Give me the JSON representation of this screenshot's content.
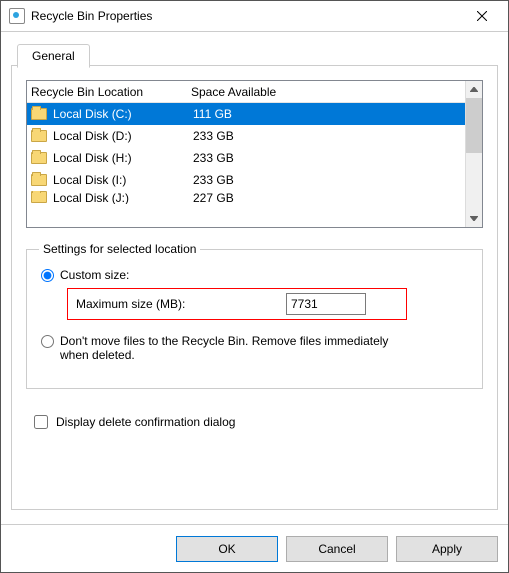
{
  "title": "Recycle Bin Properties",
  "tab": {
    "general": "General"
  },
  "list": {
    "col1": "Recycle Bin Location",
    "col2": "Space Available",
    "rows": [
      {
        "name": "Local Disk (C:)",
        "space": "111 GB"
      },
      {
        "name": "Local Disk (D:)",
        "space": "233 GB"
      },
      {
        "name": "Local Disk (H:)",
        "space": "233 GB"
      },
      {
        "name": "Local Disk (I:)",
        "space": "233 GB"
      },
      {
        "name": "Local Disk (J:)",
        "space": "227 GB"
      }
    ]
  },
  "settings": {
    "legend": "Settings for selected location",
    "custom_label": "Custom size:",
    "max_label": "Maximum size (MB):",
    "max_value": "7731",
    "dontmove_label": "Don't move files to the Recycle Bin. Remove files immediately when deleted.",
    "confirm_label": "Display delete confirmation dialog"
  },
  "buttons": {
    "ok": "OK",
    "cancel": "Cancel",
    "apply": "Apply"
  }
}
